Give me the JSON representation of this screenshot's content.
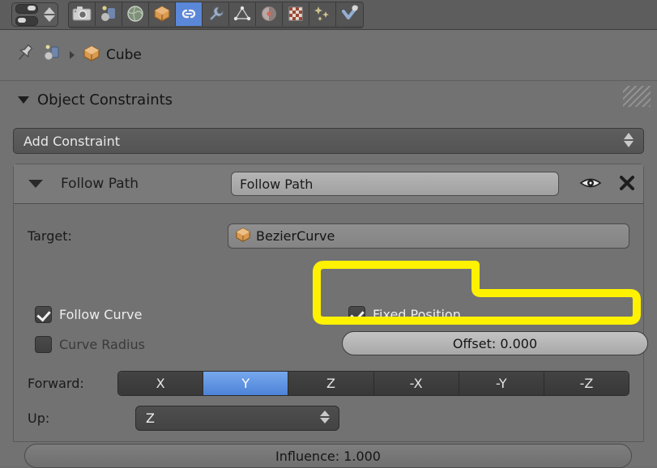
{
  "topbar": {
    "pin_toggle": "pin-id-toggle",
    "tabs": [
      {
        "name": "render",
        "label": "Render",
        "icon": "camera-icon",
        "active": false
      },
      {
        "name": "render-layers",
        "label": "Render Layers",
        "icon": "render-layers-icon",
        "active": false
      },
      {
        "name": "scene",
        "label": "Scene",
        "icon": "scene-globe-icon",
        "active": false
      },
      {
        "name": "object",
        "label": "Object",
        "icon": "object-cube-icon",
        "active": false
      },
      {
        "name": "constraints",
        "label": "Object Constraints",
        "icon": "chain-link-icon",
        "active": true
      },
      {
        "name": "modifiers",
        "label": "Modifiers",
        "icon": "wrench-icon",
        "active": false
      },
      {
        "name": "object-data",
        "label": "Object Data",
        "icon": "mesh-triangle-icon",
        "active": false
      },
      {
        "name": "material",
        "label": "Material",
        "icon": "material-sphere-icon",
        "active": false
      },
      {
        "name": "texture",
        "label": "Texture",
        "icon": "texture-checker-icon",
        "active": false
      },
      {
        "name": "particles",
        "label": "Particles",
        "icon": "particles-icon",
        "active": false
      },
      {
        "name": "physics",
        "label": "Physics",
        "icon": "physics-icon",
        "active": false
      }
    ]
  },
  "breadcrumb": {
    "pin_icon": "pin-icon",
    "object_icon": "object-properties-icon",
    "separator": "▸",
    "item_icon": "cube-icon",
    "item_label": "Cube"
  },
  "panel": {
    "disclosure": "▼",
    "title": "Object Constraints",
    "grip": "resize-grip"
  },
  "add_constraint": {
    "label": "Add Constraint",
    "arrows": "up-down-arrows"
  },
  "constraint": {
    "disclosure": "▽",
    "type_label": "Follow Path",
    "name_value": "Follow Path",
    "visibility_icon": "eye-icon",
    "delete_icon": "close-x-icon",
    "target": {
      "label": "Target:",
      "icon": "curve-object-icon",
      "value": "BezierCurve"
    },
    "follow_curve": {
      "label": "Follow Curve",
      "checked": true
    },
    "curve_radius": {
      "label": "Curve Radius",
      "checked": false
    },
    "fixed_position": {
      "label": "Fixed Position",
      "checked": true
    },
    "offset": {
      "label": "Offset: 0.000",
      "value": 0.0
    },
    "forward": {
      "label": "Forward:",
      "options": [
        "X",
        "Y",
        "Z",
        "-X",
        "-Y",
        "-Z"
      ],
      "selected": "Y"
    },
    "up": {
      "label": "Up:",
      "value": "Z",
      "arrows": "up-down-arrows"
    },
    "influence": {
      "label": "Influence: 1.000",
      "value": 1.0
    }
  },
  "highlight": {
    "name": "yellow-annotation-outline",
    "color": "#FFF200",
    "stroke_width": 9
  }
}
